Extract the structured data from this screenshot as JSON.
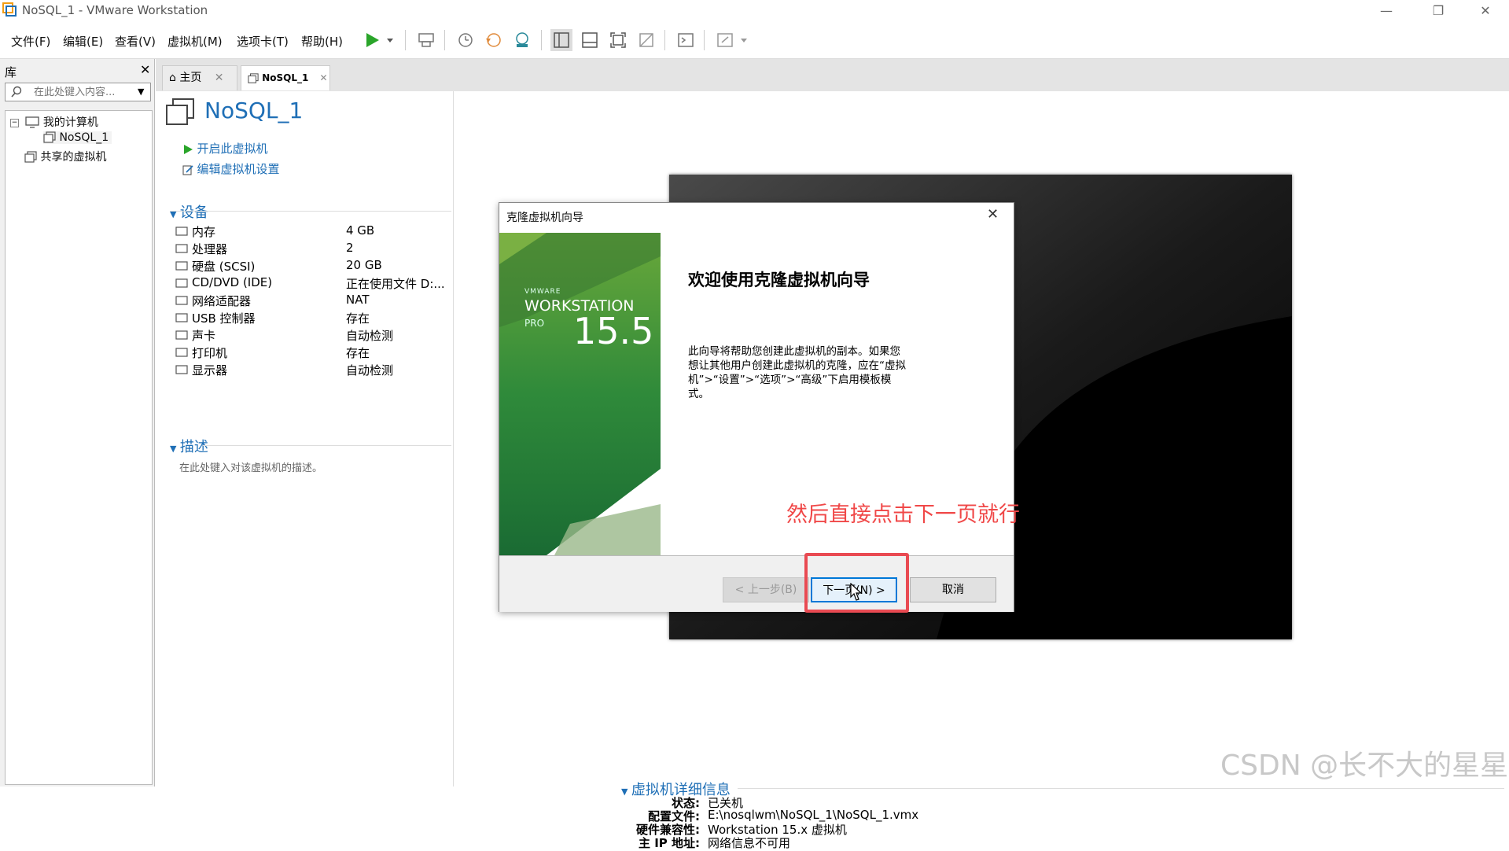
{
  "window": {
    "title": "NoSQL_1 - VMware Workstation"
  },
  "menu": [
    "文件(F)",
    "编辑(E)",
    "查看(V)",
    "虚拟机(M)",
    "选项卡(T)",
    "帮助(H)"
  ],
  "library": {
    "title": "库",
    "search_placeholder": "在此处键入内容...",
    "tree": {
      "my_computer": "我的计算机",
      "vm": "NoSQL_1",
      "shared": "共享的虚拟机"
    }
  },
  "tabs": {
    "home": "主页",
    "vm": "NoSQL_1"
  },
  "vm": {
    "title": "NoSQL_1",
    "actions": {
      "power_on": "开启此虚拟机",
      "edit_settings": "编辑虚拟机设置"
    },
    "devices_title": "设备",
    "devices": [
      {
        "label": "内存",
        "value": "4 GB"
      },
      {
        "label": "处理器",
        "value": "2"
      },
      {
        "label": "硬盘 (SCSI)",
        "value": "20 GB"
      },
      {
        "label": "CD/DVD (IDE)",
        "value": "正在使用文件 D:..."
      },
      {
        "label": "网络适配器",
        "value": "NAT"
      },
      {
        "label": "USB 控制器",
        "value": "存在"
      },
      {
        "label": "声卡",
        "value": "自动检测"
      },
      {
        "label": "打印机",
        "value": "存在"
      },
      {
        "label": "显示器",
        "value": "自动检测"
      }
    ],
    "description_title": "描述",
    "description_placeholder": "在此处键入对该虚拟机的描述。",
    "details_title": "虚拟机详细信息",
    "details": [
      {
        "key": "状态:",
        "value": "已关机"
      },
      {
        "key": "配置文件:",
        "value": "E:\\nosqlwm\\NoSQL_1\\NoSQL_1.vmx"
      },
      {
        "key": "硬件兼容性:",
        "value": "Workstation 15.x 虚拟机"
      },
      {
        "key": "主 IP 地址:",
        "value": "网络信息不可用"
      }
    ]
  },
  "dialog": {
    "title": "克隆虚拟机向导",
    "banner": {
      "brand": "VMWARE",
      "product": "WORKSTATION",
      "edition": "PRO",
      "version": "15.5"
    },
    "heading": "欢迎使用克隆虚拟机向导",
    "body": "此向导将帮助您创建此虚拟机的副本。如果您想让其他用户创建此虚拟机的克隆，应在“虚拟机”>“设置”>“选项”>“高级”下启用模板模式。",
    "buttons": {
      "back": "< 上一步(B)",
      "next": "下一页(N) >",
      "cancel": "取消"
    }
  },
  "annotation": "然后直接点击下一页就行",
  "watermark": "CSDN @长不大的星星",
  "colors": {
    "accent": "#1f6fb6",
    "annotation": "#f04848",
    "highlight": "#e94a52",
    "banner_green": "#3f8f3a"
  }
}
